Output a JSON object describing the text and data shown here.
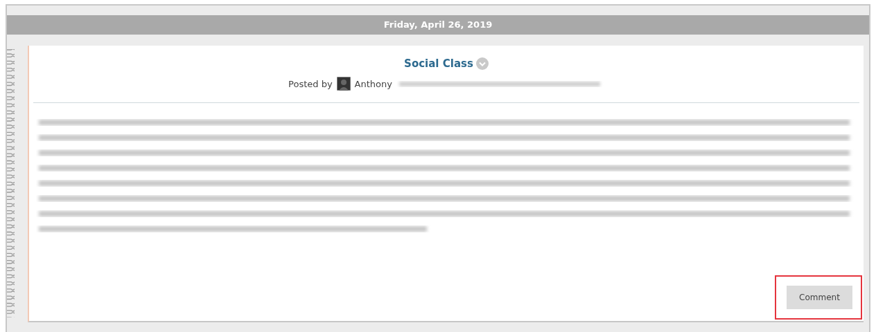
{
  "date_header": "Friday, April 26, 2019",
  "post": {
    "title": "Social Class",
    "posted_by_label": "Posted by",
    "author": "Anthony",
    "comment_button": {
      "label": "Comment",
      "highlighted": true
    }
  }
}
